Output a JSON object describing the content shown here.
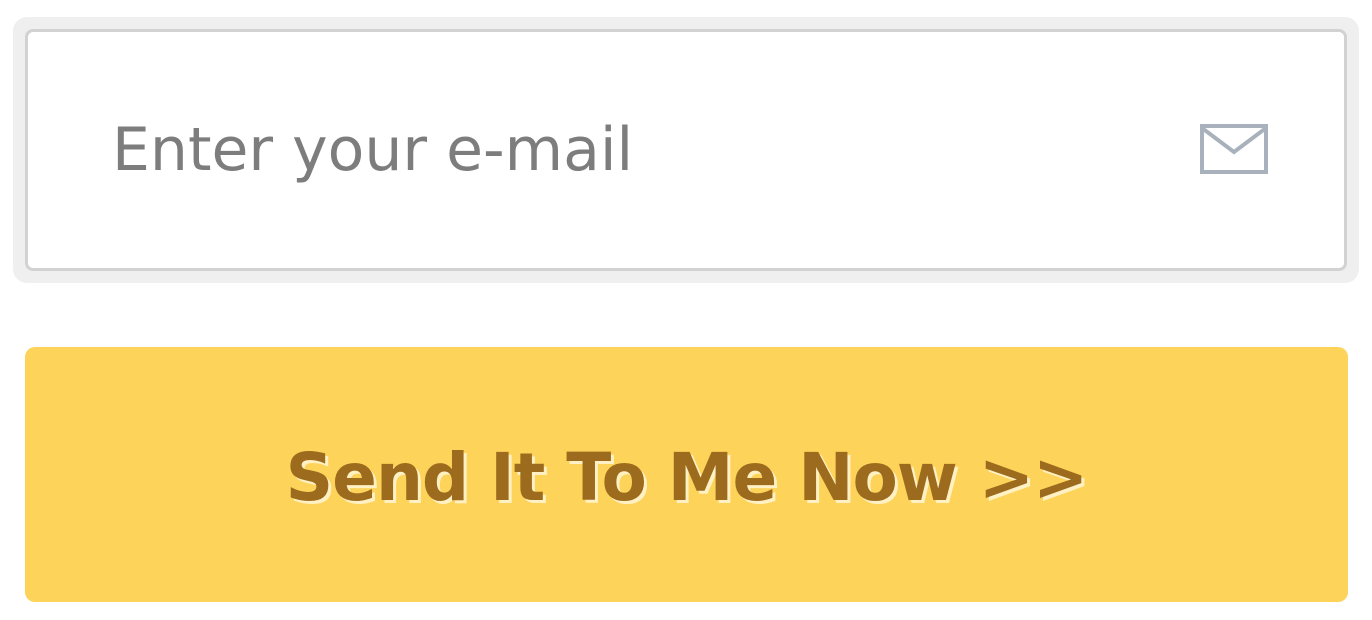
{
  "email": {
    "placeholder": "Enter your e-mail",
    "value": "",
    "icon": "envelope-icon"
  },
  "submit": {
    "label": "Send It To Me Now >>"
  },
  "colors": {
    "button_background": "#fdd359",
    "button_text": "#9c6b1d",
    "placeholder_text": "#7d7d7d",
    "field_border": "#d2d2d2",
    "field_shell": "#efefef",
    "icon_stroke": "#a9b2bc"
  }
}
